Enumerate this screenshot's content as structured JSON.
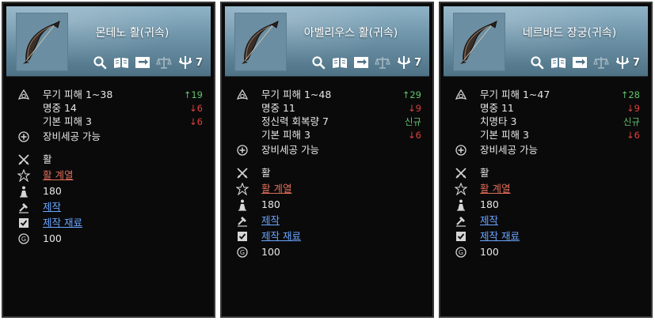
{
  "cards": [
    {
      "title": "몬테노 활(귀속)",
      "grade": "7",
      "stats": [
        {
          "label": "무기 피해 1~38",
          "cmp": "19",
          "cmp_arrow": "↑",
          "cmp_type": "up"
        },
        {
          "label": "명중 14",
          "cmp": "6",
          "cmp_arrow": "↓",
          "cmp_type": "down"
        },
        {
          "label": "기본 피해 3",
          "cmp": "6",
          "cmp_arrow": "↓",
          "cmp_type": "down"
        }
      ],
      "enhance_text": "장비세공 가능",
      "weapon_type": "활",
      "class_req": "활 계열",
      "level": "180",
      "craft": "제작",
      "craft_material": "제작 재료",
      "price": "100"
    },
    {
      "title": "아벨리우스 활(귀속)",
      "grade": "7",
      "stats": [
        {
          "label": "무기 피해 1~48",
          "cmp": "29",
          "cmp_arrow": "↑",
          "cmp_type": "up"
        },
        {
          "label": "명중 11",
          "cmp": "9",
          "cmp_arrow": "↓",
          "cmp_type": "down"
        },
        {
          "label": "정신력 회복량 7",
          "cmp": "신규",
          "cmp_arrow": "",
          "cmp_type": "new"
        },
        {
          "label": "기본 피해 3",
          "cmp": "6",
          "cmp_arrow": "↓",
          "cmp_type": "down"
        }
      ],
      "enhance_text": "장비세공 가능",
      "weapon_type": "활",
      "class_req": "활 계열",
      "level": "180",
      "craft": "제작",
      "craft_material": "제작 재료",
      "price": "100"
    },
    {
      "title": "네르바드 장궁(귀속)",
      "grade": "7",
      "stats": [
        {
          "label": "무기 피해 1~47",
          "cmp": "28",
          "cmp_arrow": "↑",
          "cmp_type": "up"
        },
        {
          "label": "명중 11",
          "cmp": "9",
          "cmp_arrow": "↓",
          "cmp_type": "down"
        },
        {
          "label": "치명타 3",
          "cmp": "신규",
          "cmp_arrow": "",
          "cmp_type": "new"
        },
        {
          "label": "기본 피해 3",
          "cmp": "6",
          "cmp_arrow": "↓",
          "cmp_type": "down"
        }
      ],
      "enhance_text": "장비세공 가능",
      "weapon_type": "활",
      "class_req": "활 계열",
      "level": "180",
      "craft": "제작",
      "craft_material": "제작 재료",
      "price": "100"
    }
  ],
  "colors": {
    "header_top": "#8fb3c6",
    "header_bottom": "#4f7285",
    "panel_bg": "#0a0a0b",
    "stat_up": "#63c46c",
    "stat_down": "#e0403a",
    "link_red": "#e06d58",
    "link_blue": "#6aa6ff"
  },
  "icons": {
    "header_tools": [
      "magnifier-icon",
      "book-icon",
      "swap-icon",
      "scale-icon",
      "trident-grade-icon"
    ],
    "stat_row": "triquetra-icon",
    "enhance_row": "circle-plus-icon",
    "weapon_row": "crossed-swords-icon",
    "class_row": "class-emblem-icon",
    "level_row": "level-figure-icon",
    "craft_row": "craft-hammer-icon",
    "material_row": "checkbox-icon",
    "price_row": "coin-icon"
  }
}
